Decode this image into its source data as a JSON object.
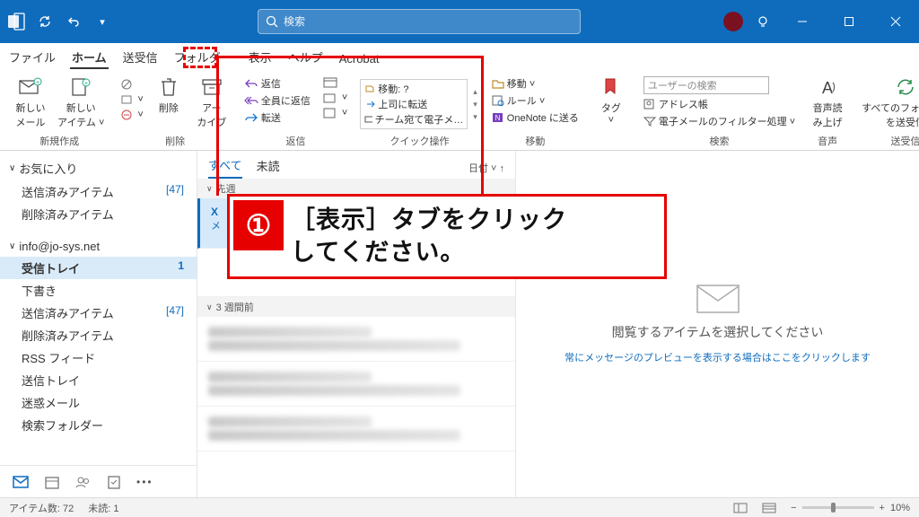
{
  "titlebar": {
    "search_placeholder": "検索"
  },
  "tabs": {
    "file": "ファイル",
    "home": "ホーム",
    "sendrecv": "送受信",
    "folder": "フォルダー",
    "view": "表示",
    "help": "ヘルプ",
    "acrobat": "Acrobat"
  },
  "ribbon": {
    "new": {
      "mail": "新しい\nメール",
      "item": "新しい\nアイテム ˅",
      "label": "新規作成"
    },
    "delete": {
      "delete": "削除",
      "archive": "アー\nカイブ",
      "label": "削除"
    },
    "reply": {
      "reply": "返信",
      "replyall": "全員に返信",
      "forward": "転送",
      "label": "返信"
    },
    "quick": {
      "a": "移動: ?",
      "b": "上司に転送",
      "c": "チーム宛て電子メ…",
      "label": "クイック操作"
    },
    "move": {
      "move": "移動 ˅",
      "rules": "ルール ˅",
      "onenote": "OneNote に送る",
      "label": "移動"
    },
    "tag": {
      "tag": "タグ\n˅"
    },
    "search": {
      "placeholder": "ユーザーの検索",
      "addr": "アドレス帳",
      "filter": "電子メールのフィルター処理 ˅",
      "label": "検索"
    },
    "speech": {
      "read": "音声読\nみ上げ",
      "label": "音声"
    },
    "sync": {
      "btn": "すべてのフォルダー\nを送受信",
      "label": "送受信"
    }
  },
  "nav": {
    "fav": "お気に入り",
    "sent": "送信済みアイテム",
    "sent_c": "[47]",
    "deleted": "削除済みアイテム",
    "account": "info@jo-sys.net",
    "inbox": "受信トレイ",
    "inbox_c": "1",
    "draft": "下書き",
    "sent2": "送信済みアイテム",
    "sent2_c": "[47]",
    "deleted2": "削除済みアイテム",
    "rss": "RSS フィード",
    "outbox": "送信トレイ",
    "junk": "迷惑メール",
    "searchf": "検索フォルダー"
  },
  "list": {
    "all": "すべて",
    "unread": "未読",
    "sort": "日付 ˅  ↑",
    "g1": "先週",
    "g2": "3 週間前",
    "sel_from": "X",
    "sel_sub": "メ"
  },
  "read": {
    "msg": "閲覧するアイテムを選択してください",
    "link": "常にメッセージのプレビューを表示する場合はここをクリックします"
  },
  "status": {
    "items": "アイテム数: 72",
    "unread": "未読: 1",
    "zoom": "10%"
  },
  "annot": {
    "num": "①",
    "text": "［表示］タブをクリック\nしてください。"
  }
}
